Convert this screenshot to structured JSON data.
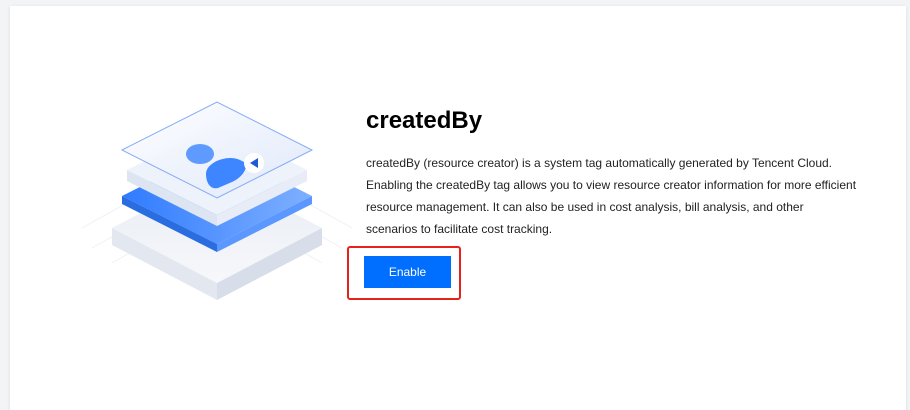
{
  "feature": {
    "title": "createdBy",
    "description": "createdBy (resource creator) is a system tag automatically generated by Tencent Cloud. Enabling the createdBy tag allows you to view resource creator information for more efficient resource management. It can also be used in cost analysis, bill analysis, and other scenarios to facilitate cost tracking.",
    "enable_label": "Enable"
  },
  "colors": {
    "primary": "#006eff",
    "highlight_border": "#e5231c",
    "illustration_blue": "#3d86ff",
    "illustration_light": "#e8efff"
  },
  "illustration": {
    "icon": "user-stack-icon",
    "badge_icon": "user-badge-icon"
  }
}
